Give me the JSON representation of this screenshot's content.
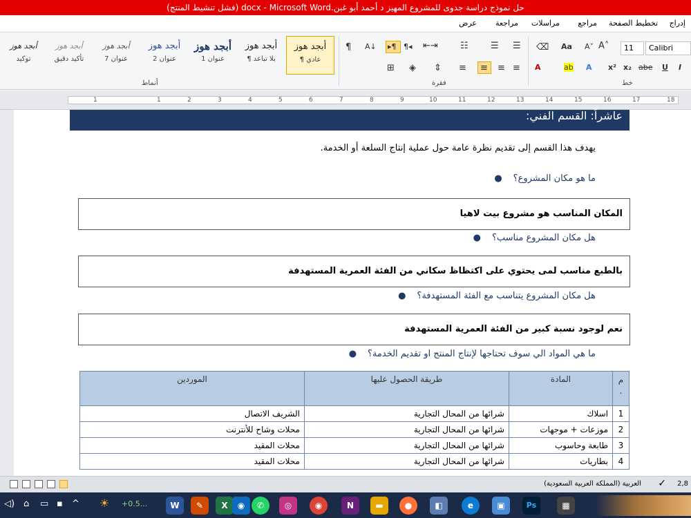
{
  "window": {
    "title": "حل نموذج دراسة جدوى للمشروع المهيز د أحمد  أبو غبن.docx  -  Microsoft Word (فشل تنشيط المنتج)"
  },
  "ribbon_tabs": [
    "إدراج",
    "تخطيط الصفحة",
    "مراجع",
    "مراسلات",
    "مراجعة",
    "عرض"
  ],
  "ribbon": {
    "styles_group_label": "أنماط",
    "paragraph_group_label": "فقرة",
    "font_group_label": "خط",
    "font_name": "Calibri",
    "font_size": "11",
    "styles": [
      {
        "sample": "أبجد هوز",
        "name": "¶ عادي",
        "selected": true
      },
      {
        "sample": "أبجد هوز",
        "name": "¶ بلا تباعد",
        "selected": false
      },
      {
        "sample": "أبجد هوز",
        "name": "عنوان 1",
        "selected": false
      },
      {
        "sample": "أبجد هوز",
        "name": "عنوان 2",
        "selected": false
      },
      {
        "sample": "أبجد هوز",
        "name": "عنوان 7",
        "selected": false
      },
      {
        "sample": "أبجد هوز",
        "name": "تأكيد دقيق",
        "selected": false
      },
      {
        "sample": "أبجد هوز",
        "name": "توكيد",
        "selected": false
      }
    ],
    "toolbar_glyphs": {
      "bold": "B",
      "italic": "I",
      "underline": "U",
      "strike": "abe",
      "subscript": "x₂",
      "superscript": "x²",
      "grow": "A˄",
      "shrink": "A˅",
      "change_case": "Aa",
      "font_color": "A",
      "highlight": "ab",
      "pilcrow": "¶",
      "sort": "A↓",
      "rtl": "¶◂",
      "ltr": "▸¶"
    }
  },
  "ruler": {
    "numbers": [
      "1",
      "1",
      "2",
      "3",
      "4",
      "5",
      "6",
      "7",
      "8",
      "9",
      "10",
      "11",
      "12",
      "13",
      "14",
      "15",
      "16",
      "17",
      "18"
    ]
  },
  "document": {
    "section_heading": "عاشراً: القسم الفني:",
    "intro": "يهدف هذا القسم إلى تقديم نظرة عامة حول عملية إنتاج السلعة أو الخدمة.",
    "q1": "ما هو مكان المشروع؟",
    "a1": "المكان المناسب هو مشروع بيت لاهيا",
    "q2": "هل مكان المشروع مناسب؟",
    "a2": "بالطبع مناسب لمى يحتوي على اكتظاظ سكاني من الفئة العمرية المستهدفة",
    "q3": "هل مكان المشروع يتناسب مع الفئة المستهدفة؟",
    "a3": "نعم لوجود نسبة كبير من الفئة العمرية المستهدفة",
    "q4": "ما هي المواد الي سوف تحتاجها لإنتاج المنتج او تقديم الخدمة؟",
    "table": {
      "headers": [
        "م",
        "المادة",
        "طريقة الحصول عليها",
        "الموردين"
      ],
      "header_no_dot": ".",
      "rows": [
        [
          "1",
          "اسلاك",
          "شرائها من المحال التجارية",
          "الشريف الاتصال"
        ],
        [
          "2",
          "موزعات + موجهات",
          "شرائها من المحال التجارية",
          "محلات وشاح للأنترنت"
        ],
        [
          "3",
          "طابعة وحاسوب",
          "شرائها من المحال التجارية",
          "محلات المقيد"
        ],
        [
          "4",
          "بطاريات",
          "شرائها من المحال التجارية",
          "محلات المقيد"
        ]
      ]
    }
  },
  "status": {
    "language": "العربية (المملكة العربية السعودية)",
    "page_info": "2,8"
  },
  "taskbar": {
    "weather": "+0.5...",
    "apps": [
      {
        "icon": "word-icon",
        "glyph": "W",
        "color": "#2b579a"
      },
      {
        "icon": "paint-icon",
        "glyph": "✎",
        "color": "#d04a02"
      },
      {
        "icon": "excel-icon",
        "glyph": "X",
        "color": "#217346"
      },
      {
        "icon": "screen-icon",
        "glyph": "◉",
        "color": "#0f6cbd"
      },
      {
        "icon": "whatsapp-icon",
        "glyph": "✆",
        "color": "#25d366"
      },
      {
        "icon": "instagram-icon",
        "glyph": "◎",
        "color": "#c13584"
      },
      {
        "icon": "chrome-icon",
        "glyph": "◉",
        "color": "#db4437"
      },
      {
        "icon": "visual-studio-icon",
        "glyph": "N",
        "color": "#68217a"
      },
      {
        "icon": "folder-icon",
        "glyph": "▬",
        "color": "#e8a600"
      },
      {
        "icon": "firefox-icon",
        "glyph": "●",
        "color": "#ff7139"
      },
      {
        "icon": "notes-icon",
        "glyph": "◧",
        "color": "#5b7db1"
      },
      {
        "icon": "edge-icon",
        "glyph": "e",
        "color": "#0c7bd1"
      },
      {
        "icon": "store-icon",
        "glyph": "▣",
        "color": "#4a8bd6"
      },
      {
        "icon": "photoshop-icon",
        "glyph": "Ps",
        "color": "#31a8ff"
      },
      {
        "icon": "calculator-icon",
        "glyph": "▦",
        "color": "#444444"
      }
    ]
  }
}
